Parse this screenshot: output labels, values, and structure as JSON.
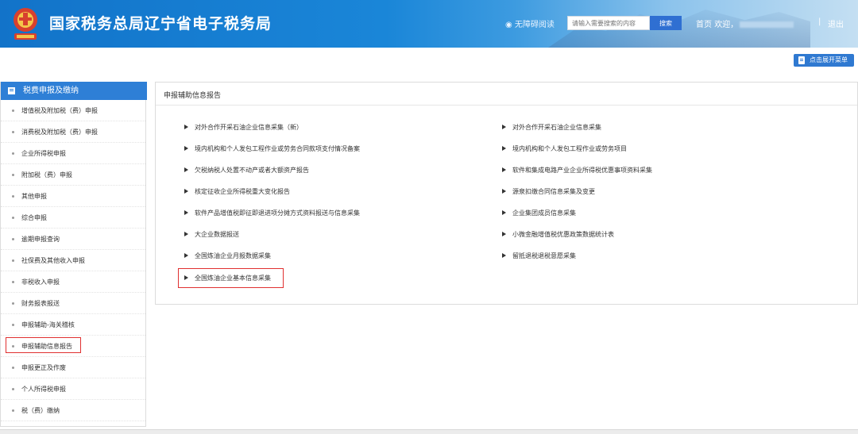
{
  "header": {
    "title": "国家税务总局辽宁省电子税务局",
    "accessible_label": "无障碍阅读",
    "search_placeholder": "请输入需要搜索的内容",
    "search_button": "搜索",
    "home_label": "首页",
    "welcome_label": "欢迎，",
    "separator": "|",
    "logout_label": "退出",
    "brand_color": "#1a86d8"
  },
  "toolbar": {
    "expand_menu_label": "点击展开菜单"
  },
  "sidebar": {
    "heading": "税费申报及缴纳",
    "items": [
      {
        "label": "增值税及附加税（费）申报"
      },
      {
        "label": "消费税及附加税（费）申报"
      },
      {
        "label": "企业所得税申报"
      },
      {
        "label": "附加税（费）申报"
      },
      {
        "label": "其他申报"
      },
      {
        "label": "综合申报"
      },
      {
        "label": "逾期申报查询"
      },
      {
        "label": "社保费及其他收入申报"
      },
      {
        "label": "非税收入申报"
      },
      {
        "label": "财务报表报送"
      },
      {
        "label": "申报辅助-海关稽核"
      },
      {
        "label": "申报辅助信息报告"
      },
      {
        "label": "申报更正及作废"
      },
      {
        "label": "个人所得税申报"
      },
      {
        "label": "税（费）缴纳"
      }
    ],
    "selected_index": 11
  },
  "main": {
    "panel_title": "申报辅助信息报告",
    "left_reports": [
      {
        "label": "对外合作开采石油企业信息采集（新）"
      },
      {
        "label": "境内机构和个人发包工程作业或劳务合同款项支付情况备案"
      },
      {
        "label": "欠税纳税人处置不动产或者大额资产报告"
      },
      {
        "label": "核定征收企业所得税重大变化报告"
      },
      {
        "label": "软件产品增值税即征即退进项分摊方式资料报送与信息采集"
      },
      {
        "label": "大企业数据报送"
      },
      {
        "label": "全国炼油企业月报数据采集"
      },
      {
        "label": "全国炼油企业基本信息采集"
      }
    ],
    "right_reports": [
      {
        "label": "对外合作开采石油企业信息采集"
      },
      {
        "label": "境内机构和个人发包工程作业或劳务项目"
      },
      {
        "label": "软件和集成电路产业企业所得税优惠事项资料采集"
      },
      {
        "label": "源泉扣缴合同信息采集及变更"
      },
      {
        "label": "企业集团成员信息采集"
      },
      {
        "label": "小微金融增值税优惠政策数据统计表"
      },
      {
        "label": "留抵退税退税意愿采集"
      }
    ],
    "highlighted_report": "全国炼油企业基本信息采集",
    "highlight_color": "#e03030"
  }
}
